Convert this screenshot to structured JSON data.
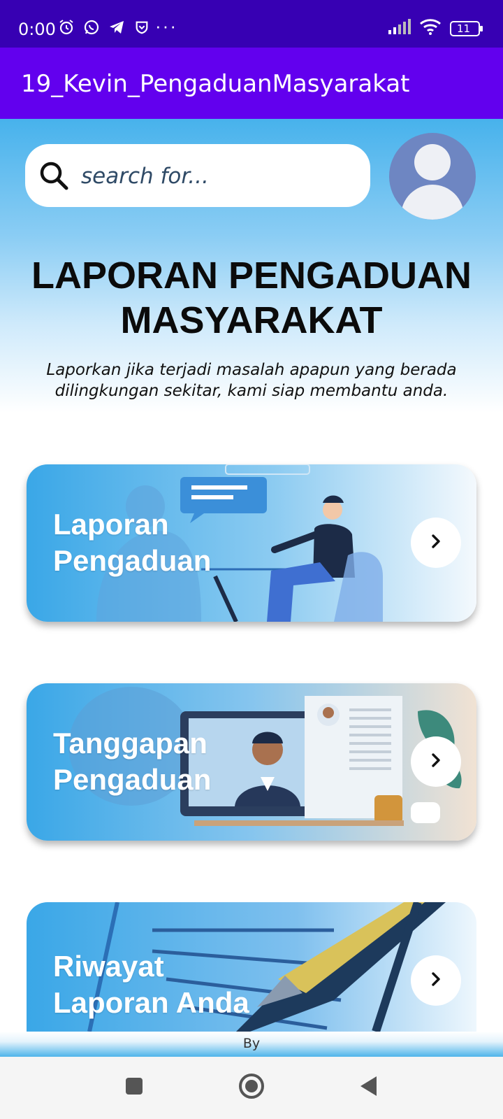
{
  "status_bar": {
    "time": "0:00",
    "more": "···",
    "battery": "11",
    "icons": [
      "alarm-icon",
      "whatsapp-icon",
      "telegram-icon",
      "shield-icon",
      "signal-icon",
      "wifi-icon",
      "battery-icon"
    ]
  },
  "app_bar": {
    "title": "19_Kevin_PengaduanMasyarakat"
  },
  "search": {
    "placeholder": "search for..."
  },
  "header": {
    "title_line1": "LAPORAN PENGADUAN",
    "title_line2": "MASYARAKAT",
    "subtitle_line1": "Laporkan jika terjadi masalah apapun yang berada",
    "subtitle_line2": "dilingkungan sekitar, kami siap membantu anda."
  },
  "cards": [
    {
      "line1": "Laporan",
      "line2": "Pengaduan",
      "icon": "chevron-right-icon"
    },
    {
      "line1": "Tanggapan",
      "line2": "Pengaduan",
      "icon": "chevron-right-icon"
    },
    {
      "line1": "Riwayat",
      "line2": "Laporan Anda",
      "icon": "chevron-right-icon"
    }
  ],
  "footer": {
    "text": "By"
  },
  "colors": {
    "status_bar": "#3700b3",
    "app_bar": "#6200ee",
    "header_gradient_top": "#47b2ec",
    "card_blue": "#3fa9e8",
    "avatar": "#6e86c2"
  },
  "nav": {
    "icons": [
      "recent-apps-icon",
      "home-icon",
      "back-icon"
    ]
  }
}
